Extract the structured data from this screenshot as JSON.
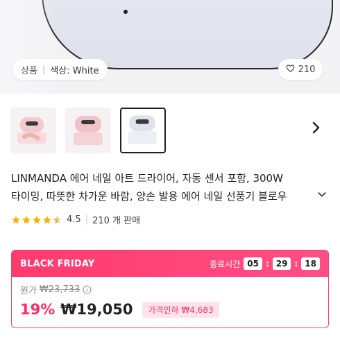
{
  "hero": {
    "variant_key": "상품",
    "variant_value": "색상: White",
    "like_count": "210"
  },
  "thumbnails": [
    {
      "name": "thumb-pink-dryer-hand",
      "color": "pink"
    },
    {
      "name": "thumb-pink-dryer",
      "color": "pink"
    },
    {
      "name": "thumb-white-dryer",
      "color": "white",
      "selected": true
    }
  ],
  "product": {
    "title_line1": "LINMANDA 에어 네일 아트 드라이어, 자동 센서 포함, 300W",
    "title_line2": "타이밍, 따뜻한 차가운 바람, 양손 발용 에어 네일 선풍기 블로우"
  },
  "rating": {
    "score": "4.5",
    "stars": 4.5,
    "sold": "210 개 판매"
  },
  "deal": {
    "label": "BLACK FRIDAY",
    "timer_label": "종료시간",
    "hours": "05",
    "minutes": "29",
    "seconds": "18",
    "original_label": "원가",
    "original_price": "₩23,733",
    "discount": "19%",
    "price": "₩19,050",
    "price_cut": "가격인하 ₩4,683",
    "accent": "#ff3a6e"
  }
}
